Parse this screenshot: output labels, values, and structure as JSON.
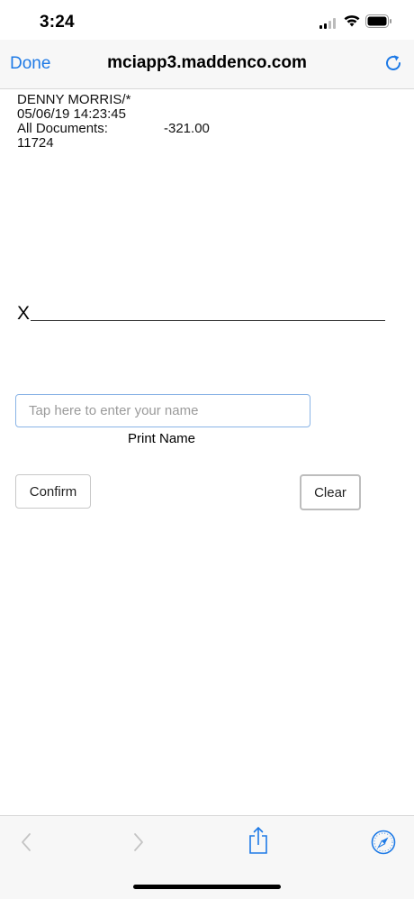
{
  "status_bar": {
    "time": "3:24"
  },
  "nav": {
    "done_label": "Done",
    "title": "mciapp3.maddenco.com"
  },
  "document": {
    "line1": "DENNY MORRIS/*",
    "line2": "05/06/19 14:23:45",
    "amount_label": "All Documents:",
    "amount_value": "-321.00",
    "line4": "11724"
  },
  "signature": {
    "x_label": "X"
  },
  "name_field": {
    "placeholder": "Tap here to enter your name",
    "value": ""
  },
  "print_name_label": "Print Name",
  "buttons": {
    "confirm_label": "Confirm",
    "clear_label": "Clear"
  },
  "toolbar": {
    "icons": [
      "chevron-left-icon",
      "chevron-right-icon",
      "share-icon",
      "compass-icon"
    ]
  },
  "colors": {
    "accent": "#1e7ae6",
    "field_border": "#8ab4e6"
  }
}
